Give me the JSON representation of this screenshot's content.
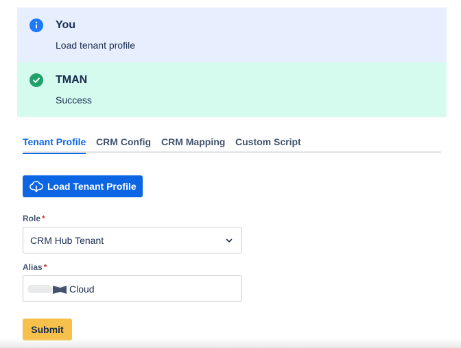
{
  "flags": {
    "info": {
      "title": "You",
      "body": "Load tenant profile",
      "icon": "info-icon",
      "color": "#1d7afc"
    },
    "success": {
      "title": "TMAN",
      "body": "Success",
      "icon": "check-circle-icon",
      "color": "#22a06b"
    }
  },
  "tabs": [
    {
      "label": "Tenant Profile",
      "active": true
    },
    {
      "label": "CRM Config",
      "active": false
    },
    {
      "label": "CRM Mapping",
      "active": false
    },
    {
      "label": "Custom Script",
      "active": false
    }
  ],
  "load_button": {
    "label": "Load Tenant Profile",
    "icon": "cloud-download-icon"
  },
  "form": {
    "role": {
      "label": "Role",
      "required_mark": "*",
      "value": "CRM Hub Tenant"
    },
    "alias": {
      "label": "Alias",
      "required_mark": "*",
      "value": "Cloud"
    }
  },
  "submit": {
    "label": "Submit"
  },
  "colors": {
    "primary": "#0c66e4",
    "submit": "#f5c14b",
    "info_bg": "#e7eefd",
    "success_bg": "#d5fbee"
  }
}
